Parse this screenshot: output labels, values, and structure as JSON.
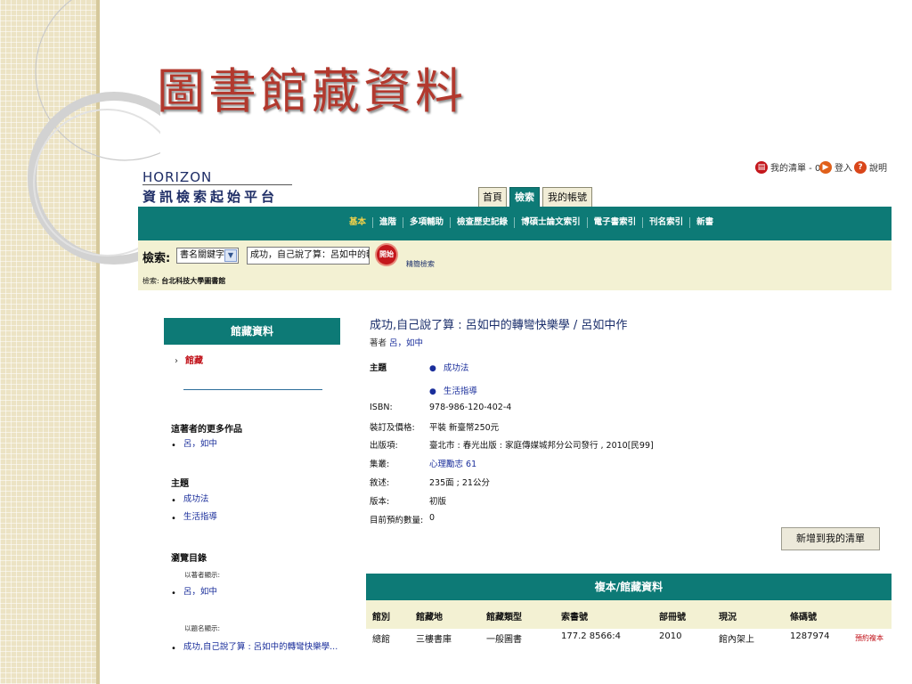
{
  "slide": {
    "title": "圖書館藏資料"
  },
  "header": {
    "logo_top": "HORIZON",
    "logo_bottom": "資訊檢索起始平台",
    "top_links": {
      "my_list": "我的清單 - 0",
      "login": "登入",
      "help": "說明"
    },
    "tabs": [
      "首頁",
      "檢索",
      "我的帳號"
    ]
  },
  "nav": {
    "items": [
      "基本",
      "進階",
      "多項輔助",
      "檢查歷史記錄",
      "博碩士論文索引",
      "電子書索引",
      "刊名索引",
      "新書"
    ]
  },
  "search": {
    "label": "檢索:",
    "select_value": "書名關鍵字",
    "query": "成功，自己說了算：呂如中的轉彎快樂學",
    "go_label": "開始",
    "simple_label": "精簡檢索",
    "library_prefix": "檢索:",
    "library_name": "台北科技大學圖書館"
  },
  "left_panel": {
    "title": "館藏資料",
    "current": "館藏",
    "more_works_title": "這著者的更多作品",
    "more_works": [
      "呂，如中"
    ],
    "subject_title": "主題",
    "subjects": [
      "成功法",
      "生活指導"
    ],
    "browse_title": "瀏覽目錄",
    "by_author_note": "以著者顯示:",
    "by_author": "呂，如中",
    "by_title_note": "以題名顯示:",
    "by_title": "成功,自己說了算 : 呂如中的轉彎快樂學..."
  },
  "record": {
    "title": "成功,自己說了算 : 呂如中的轉彎快樂學 / 呂如中作",
    "author_label": "著者",
    "author": "呂，如中",
    "subject_label": "主題",
    "subjects": [
      "成功法",
      "生活指導"
    ],
    "fields": [
      {
        "label": "ISBN:",
        "value": "978-986-120-402-4"
      },
      {
        "label": "裝訂及價格:",
        "value": "平裝 新臺幣250元"
      },
      {
        "label": "出版項:",
        "value": "臺北市 : 春光出版 : 家庭傳媒城邦分公司發行 , 2010[民99]"
      },
      {
        "label": "集叢:",
        "value": "心理勵志 61",
        "link": true
      },
      {
        "label": "敘述:",
        "value": "235面 ; 21公分"
      },
      {
        "label": "版本:",
        "value": "初版"
      },
      {
        "label": "目前預約數量:",
        "value": "0"
      }
    ],
    "add_button": "新增到我的清單"
  },
  "copies": {
    "title": "複本/館藏資料",
    "headers": [
      "館別",
      "館藏地",
      "館藏類型",
      "索書號",
      "部冊號",
      "現況",
      "條碼號"
    ],
    "rows": [
      [
        "總館",
        "三樓書庫",
        "一般圖書",
        "177.2 8566:4",
        "2010",
        "館內架上",
        "1287974",
        "預約複本"
      ]
    ]
  },
  "colors": {
    "teal": "#0d7a76",
    "cream": "#f3f1d3",
    "title_red": "#b2392e",
    "link_blue": "#1a2e9b"
  }
}
